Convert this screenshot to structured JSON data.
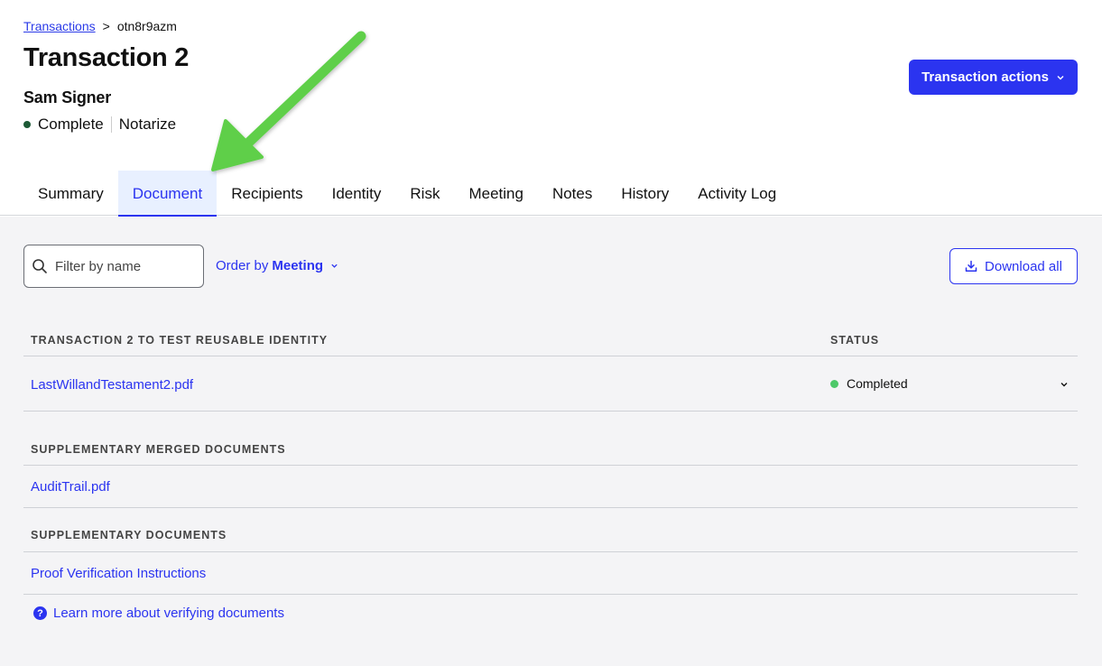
{
  "breadcrumb": {
    "root": "Transactions",
    "separator": ">",
    "current": "otn8r9azm"
  },
  "page_title": "Transaction 2",
  "signer_name": "Sam Signer",
  "status": {
    "state": "Complete",
    "type": "Notarize",
    "dot_color": "#1d5a36"
  },
  "actions_button": {
    "label": "Transaction actions",
    "icon": "chevron-down-icon"
  },
  "tabs": [
    {
      "label": "Summary",
      "active": false
    },
    {
      "label": "Document",
      "active": true
    },
    {
      "label": "Recipients",
      "active": false
    },
    {
      "label": "Identity",
      "active": false
    },
    {
      "label": "Risk",
      "active": false
    },
    {
      "label": "Meeting",
      "active": false
    },
    {
      "label": "Notes",
      "active": false
    },
    {
      "label": "History",
      "active": false
    },
    {
      "label": "Activity Log",
      "active": false
    }
  ],
  "toolbar": {
    "filter_placeholder": "Filter by name",
    "filter_value": "",
    "order_prefix": "Order by",
    "order_value": "Meeting",
    "download_label": "Download all"
  },
  "sections": {
    "main": {
      "title": "Transaction 2 to test reusable identity",
      "status_header": "Status",
      "documents": [
        {
          "name": "LastWillandTestament2.pdf",
          "status": "Completed",
          "status_color": "#4ec96a"
        }
      ]
    },
    "merged": {
      "title": "Supplementary merged documents",
      "documents": [
        {
          "name": "AuditTrail.pdf"
        }
      ]
    },
    "supplementary": {
      "title": "Supplementary documents",
      "documents": [
        {
          "name": "Proof Verification Instructions"
        }
      ]
    }
  },
  "learn_more": {
    "label": "Learn more about verifying documents",
    "icon": "help-icon"
  },
  "colors": {
    "accent": "#2b34f0",
    "annotation_arrow": "#5ecf4a"
  }
}
